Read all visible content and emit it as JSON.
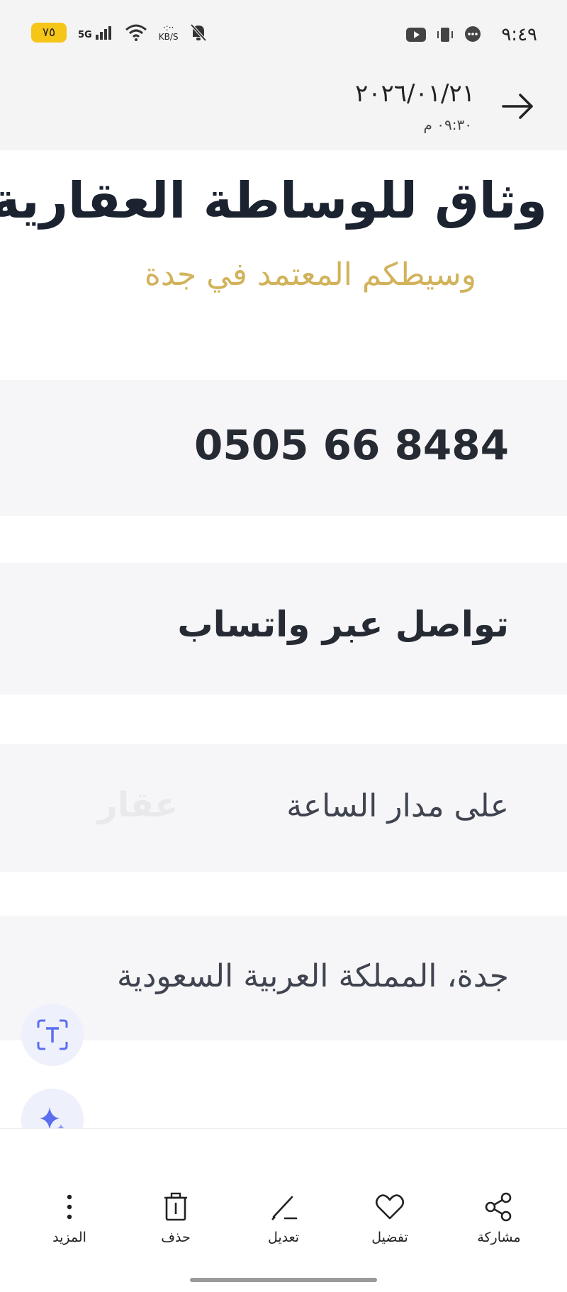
{
  "status_bar": {
    "time": "٩:٤٩",
    "battery": "٧٥",
    "network": "5G",
    "speed_value": "·:··",
    "speed_unit": "KB/S"
  },
  "header": {
    "date": "٢٠٢٦/٠١/٢١",
    "time": "٠٩:٣٠ م"
  },
  "document": {
    "title": "وثاق للوساطة العقارية",
    "subtitle": "وسيطكم المعتمد في جدة",
    "phone": "0505 66 8484",
    "whatsapp": "تواصل عبر واتساب",
    "hours": "على مدار الساعة",
    "location": "جدة، المملكة العربية السعودية",
    "watermark": "عقار"
  },
  "actions": [
    {
      "label": "مشاركة",
      "icon": "share-icon"
    },
    {
      "label": "تفضيل",
      "icon": "heart-icon"
    },
    {
      "label": "تعديل",
      "icon": "pencil-icon"
    },
    {
      "label": "حذف",
      "icon": "trash-icon"
    },
    {
      "label": "المزيد",
      "icon": "more-vertical-icon"
    }
  ],
  "colors": {
    "title": "#1b2230",
    "subtitle_gold": "#d2b25a",
    "band_bg": "#f6f6f8",
    "battery": "#f5c518",
    "ai_accent": "#5b6ef0"
  }
}
